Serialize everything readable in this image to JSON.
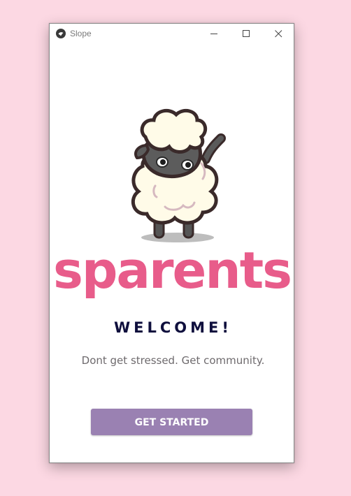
{
  "window": {
    "title": "Slope",
    "controls": {
      "minimize": "minimize",
      "maximize": "maximize",
      "close": "close"
    }
  },
  "brand": {
    "logo_text": "sparents",
    "mascot": "sheep-mascot",
    "logo_color": "#e85c8a"
  },
  "welcome": {
    "heading": "WELCOME!",
    "tagline": "Dont get stressed. Get community."
  },
  "actions": {
    "get_started_label": "GET STARTED",
    "button_color": "#9a81b2"
  },
  "theme": {
    "background": "#fcd8e3",
    "heading_color": "#0f0f3d",
    "text_color": "#6e6a6d"
  }
}
